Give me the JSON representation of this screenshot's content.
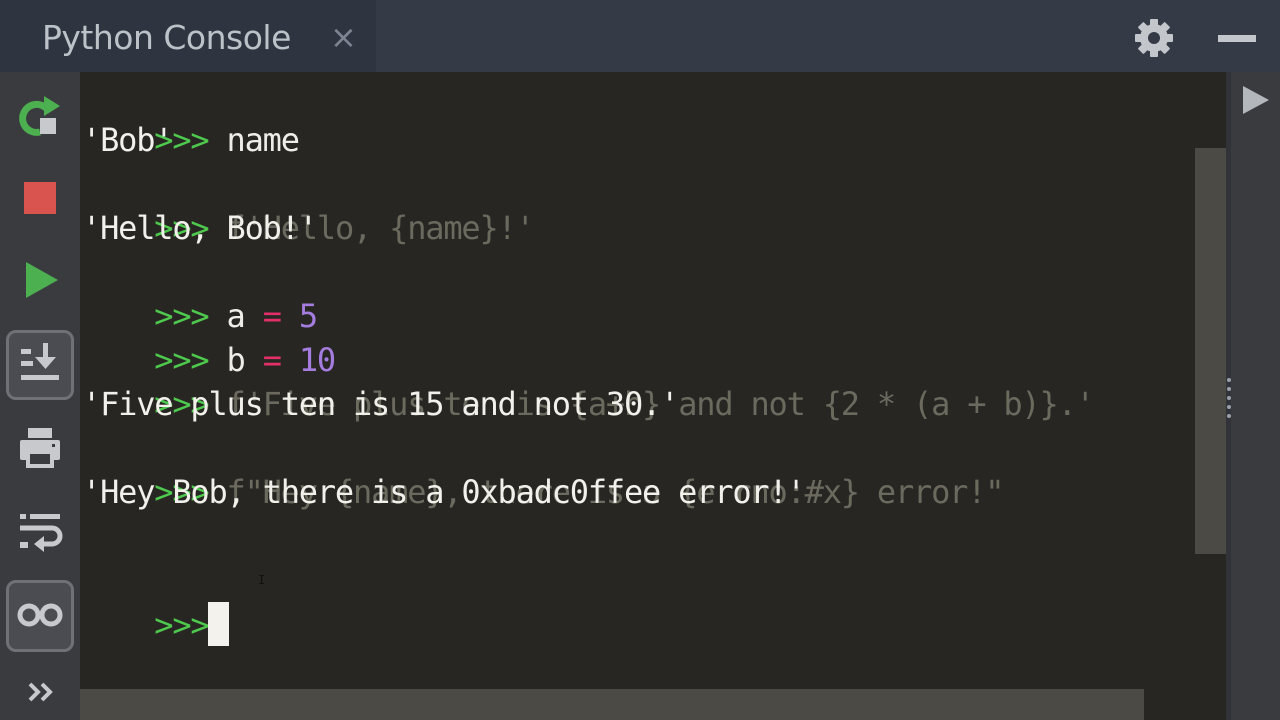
{
  "window": {
    "tab_title": "Python Console",
    "tab_close_icon": "×",
    "settings_icon": "gear-icon",
    "minimize_icon": "minimize-icon"
  },
  "toolbar": {
    "buttons": [
      {
        "name": "rerun",
        "icon": "rerun-icon",
        "color": "#4caf50"
      },
      {
        "name": "stop",
        "icon": "stop-icon",
        "color": "#d9534f"
      },
      {
        "name": "execute",
        "icon": "play-icon",
        "color": "#4caf50"
      },
      {
        "name": "scroll-to-end",
        "icon": "scroll-to-end-icon",
        "selected": true
      },
      {
        "name": "print",
        "icon": "printer-icon"
      },
      {
        "name": "soft-wrap",
        "icon": "soft-wrap-icon"
      },
      {
        "name": "show-variables",
        "icon": "glasses-icon",
        "selected": true
      },
      {
        "name": "more",
        "icon": "chevron-double-right-icon",
        "label": "»"
      }
    ]
  },
  "console": {
    "prompt": ">>>",
    "lines": [
      {
        "type": "input",
        "text": "name"
      },
      {
        "type": "output",
        "text": "'Bob'"
      },
      {
        "type": "input",
        "text": "f'Hello, {name}!'"
      },
      {
        "type": "output",
        "text": "'Hello, Bob!'"
      },
      {
        "type": "input",
        "var": "a",
        "op": "=",
        "num": "5"
      },
      {
        "type": "input",
        "var": "b",
        "op": "=",
        "num": "10"
      },
      {
        "type": "input",
        "text": "f'Five plus ten is {a+b} and not {2 * (a + b)}.'"
      },
      {
        "type": "output",
        "text": "'Five plus ten is 15 and not 30.'"
      },
      {
        "type": "input",
        "text": "f\"Hey {name}, there is a {errno:#x} error!\""
      },
      {
        "type": "output",
        "text": "'Hey Bob, there is a 0xbadc0ffee error!'"
      },
      {
        "type": "blank",
        "text": ""
      },
      {
        "type": "active-prompt",
        "text": ""
      }
    ],
    "colors": {
      "prompt": "#4ec94e",
      "string": "#6c6a5e",
      "operator": "#e32f6a",
      "number": "#a57de0",
      "output": "#f2f0ea",
      "background": "#272622"
    }
  },
  "right_panel": {
    "expand_icon": "play-right-icon"
  }
}
